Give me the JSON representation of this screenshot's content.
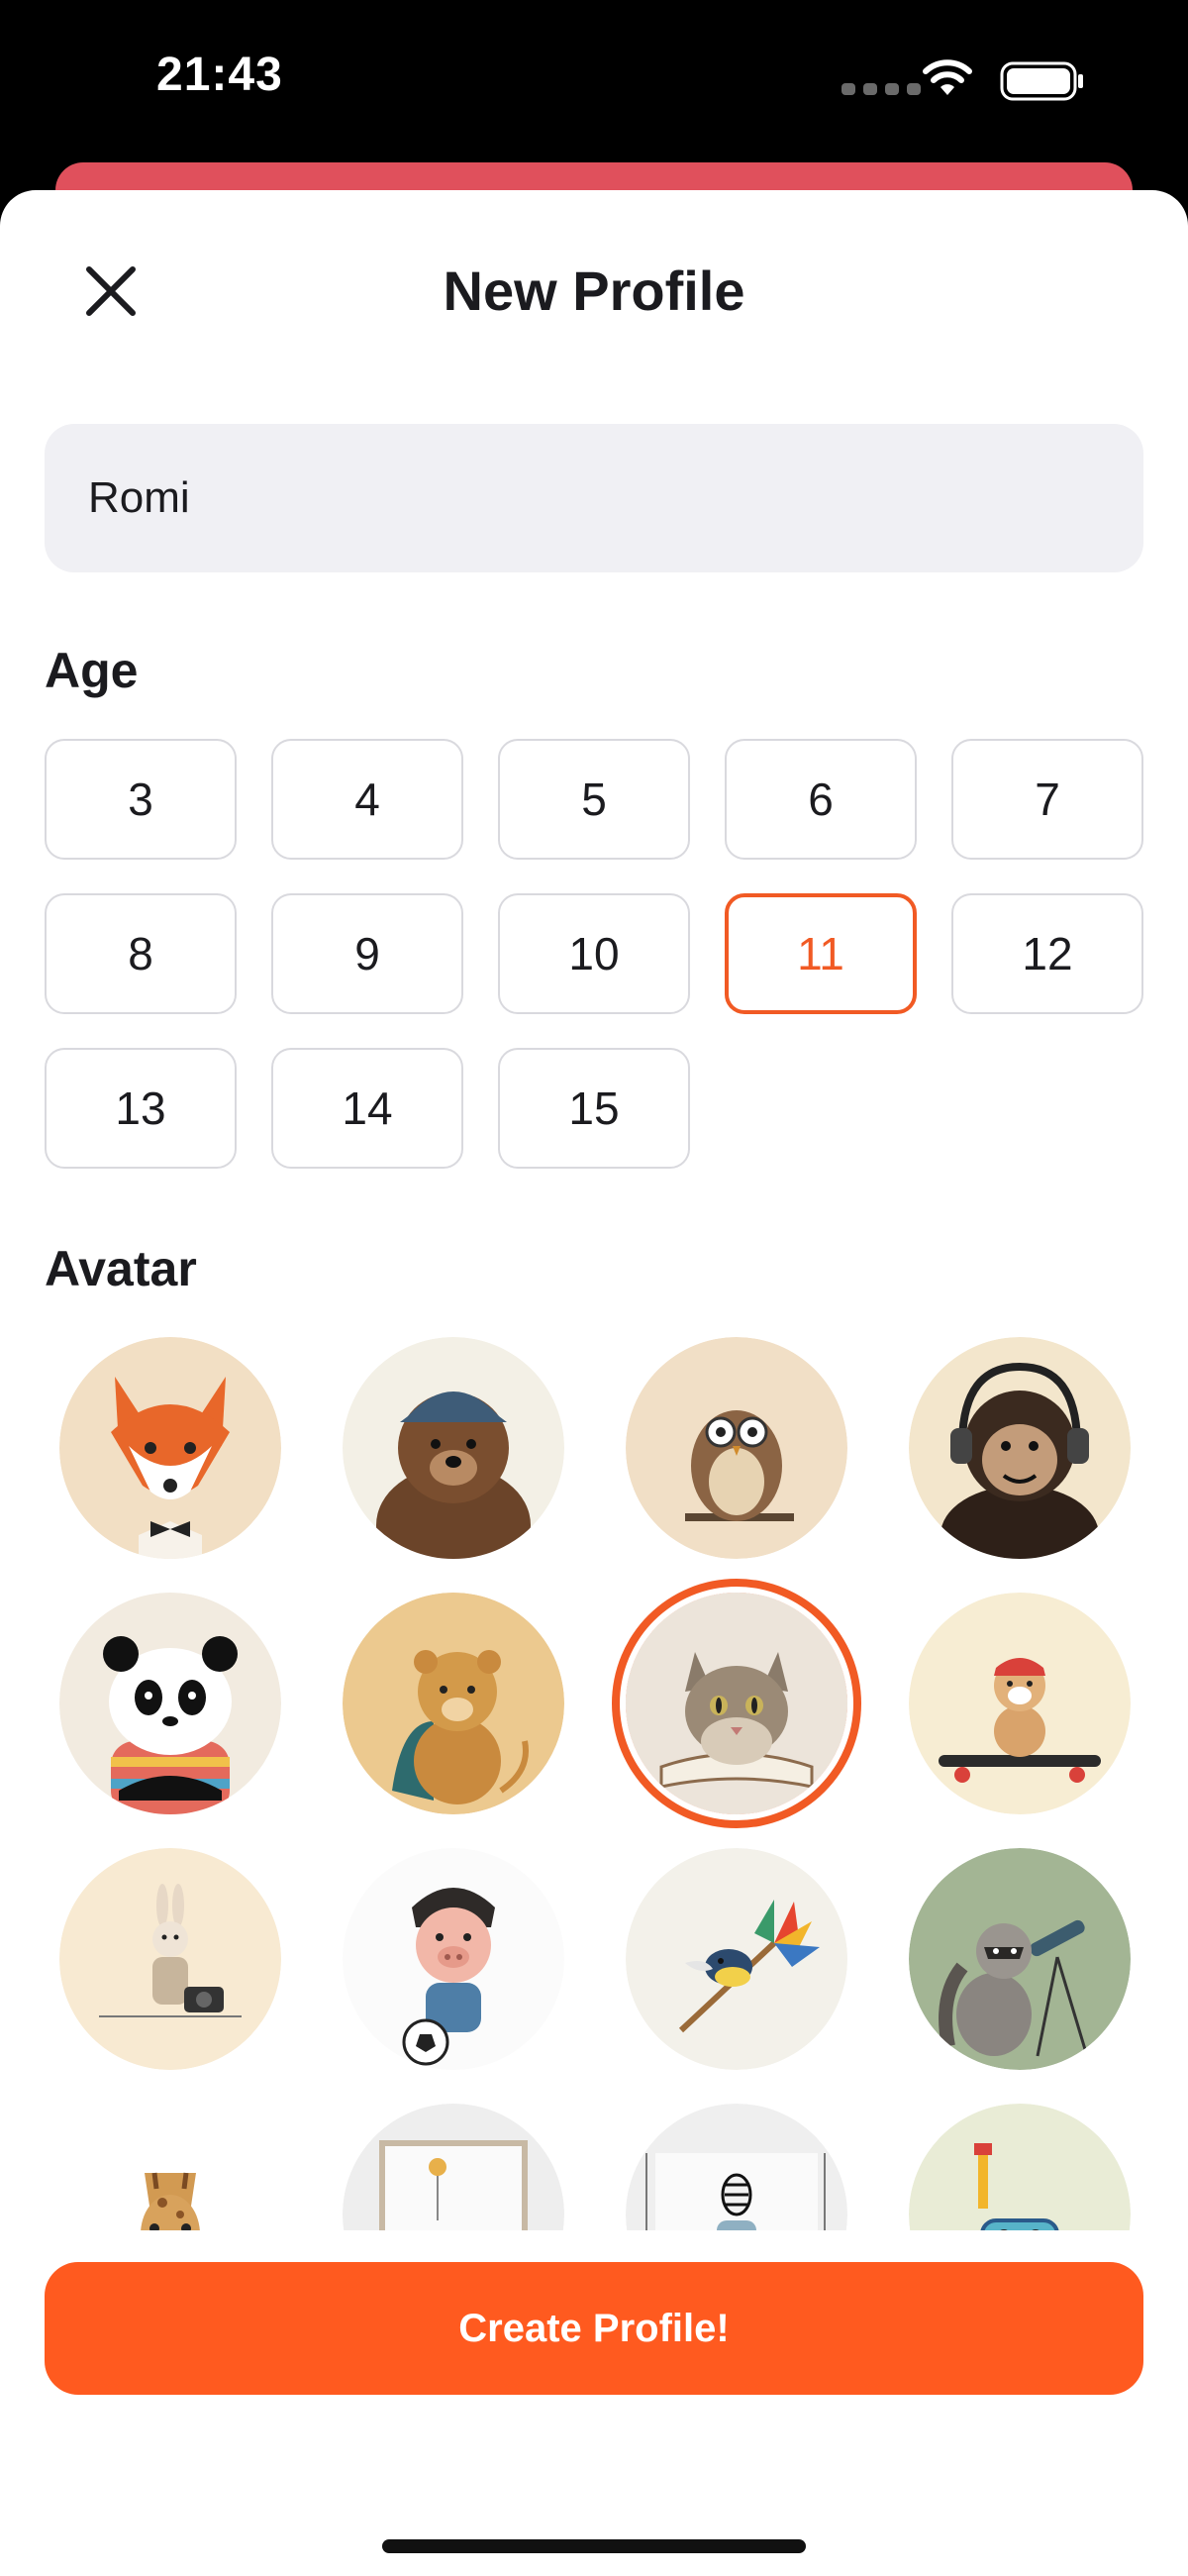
{
  "status_bar": {
    "time": "21:43"
  },
  "header": {
    "title": "New Profile"
  },
  "name_field": {
    "value": "Romi"
  },
  "age": {
    "label": "Age",
    "options": [
      "3",
      "4",
      "5",
      "6",
      "7",
      "8",
      "9",
      "10",
      "11",
      "12",
      "13",
      "14",
      "15"
    ],
    "selected": "11"
  },
  "avatar": {
    "label": "Avatar",
    "items": [
      {
        "name": "fox-bowtie",
        "icon": "fox-icon"
      },
      {
        "name": "bear-cap",
        "icon": "bear-icon"
      },
      {
        "name": "owl-glasses",
        "icon": "owl-icon"
      },
      {
        "name": "chimp-headphones",
        "icon": "chimp-icon"
      },
      {
        "name": "panda-pigtails",
        "icon": "panda-icon"
      },
      {
        "name": "lion-cub-cape",
        "icon": "lion-icon"
      },
      {
        "name": "cat-reading",
        "icon": "cat-icon"
      },
      {
        "name": "bulldog-skateboard",
        "icon": "dog-icon"
      },
      {
        "name": "bunny-camera",
        "icon": "bunny-icon"
      },
      {
        "name": "piglet-soccer",
        "icon": "pig-icon"
      },
      {
        "name": "bird-feather",
        "icon": "bird-icon"
      },
      {
        "name": "raccoon-telescope",
        "icon": "raccoon-icon"
      },
      {
        "name": "giraffe",
        "icon": "giraffe-icon"
      },
      {
        "name": "elephant-frame",
        "icon": "elephant-icon"
      },
      {
        "name": "zebra-frame",
        "icon": "zebra-icon"
      },
      {
        "name": "hippo-snorkel",
        "icon": "hippo-icon"
      }
    ],
    "selected_index": 6
  },
  "create_button": {
    "label": "Create Profile!"
  },
  "colors": {
    "accent": "#ff5a1f",
    "selected_border": "#f15a24",
    "field_bg": "#f0f0f4"
  }
}
